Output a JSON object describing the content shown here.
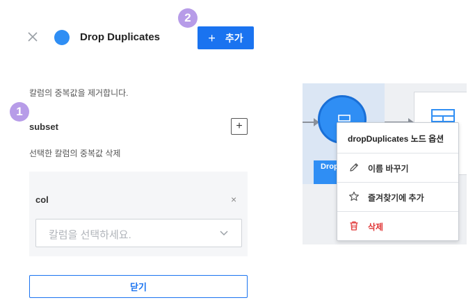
{
  "header": {
    "title": "Drop Duplicates",
    "add_button_label": "추가",
    "add_button_plus": "+",
    "close_glyph": "×"
  },
  "badges": {
    "step1": "1",
    "step2": "2"
  },
  "panel": {
    "description": "칼럼의 중복값을 제거합니다.",
    "subset_label": "subset",
    "subset_add_glyph": "+",
    "subset_description": "선택한 칼럼의 중복값 삭제",
    "column_card": {
      "label": "col",
      "remove_glyph": "×",
      "select_placeholder": "칼럼을 선택하세요."
    },
    "close_button_label": "닫기"
  },
  "canvas": {
    "node_label": "Drop Duplicates",
    "node_color": "#2f8ef4"
  },
  "context_menu": {
    "title": "dropDuplicates 노드 옵션",
    "items": [
      {
        "label": "이름 바꾸기",
        "icon": "pencil-icon"
      },
      {
        "label": "즐겨찾기에 추가",
        "icon": "star-icon"
      },
      {
        "label": "삭제",
        "icon": "trash-icon",
        "danger": true
      }
    ]
  },
  "colors": {
    "primary": "#1a73f0",
    "badge": "#b79ce8",
    "danger": "#e03535"
  }
}
